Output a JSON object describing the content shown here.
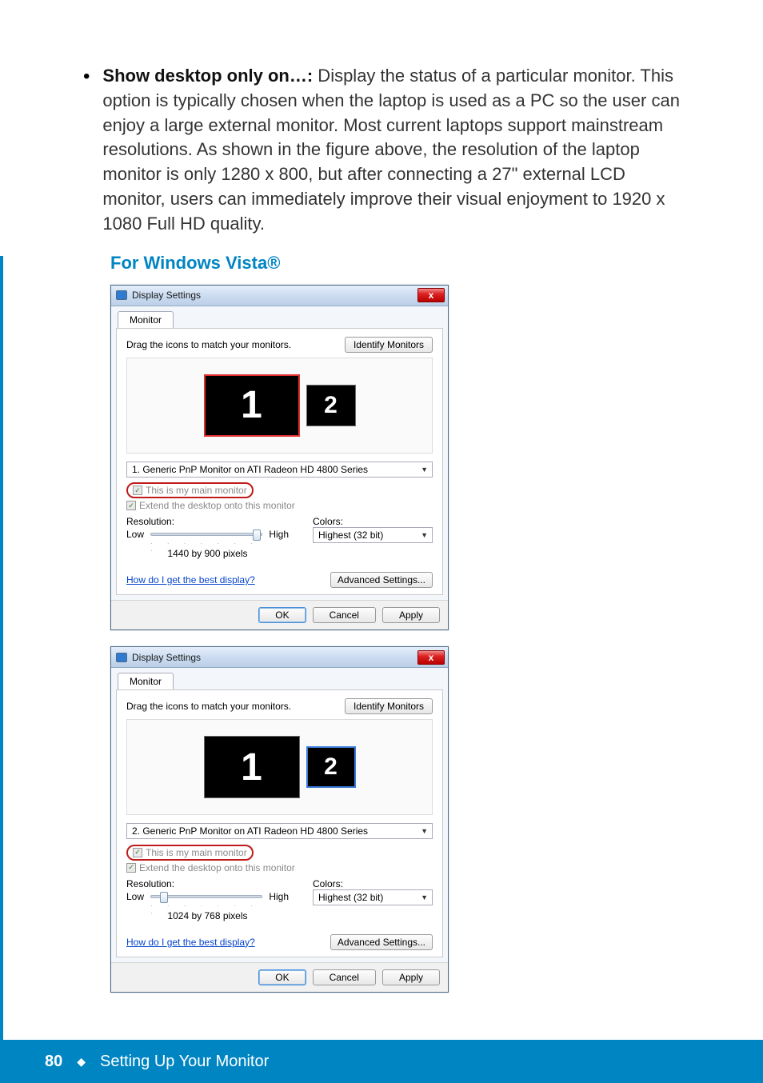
{
  "page": {
    "bullet_heading": "Show desktop only on…:",
    "bullet_body": " Display the status of a particular monitor. This option is typically chosen when the laptop is used as a PC so the user can enjoy a large external monitor. Most current laptops support mainstream resolutions. As shown in the figure above, the resolution of the laptop monitor is only 1280 x 800, but after connecting a 27\" external LCD monitor, users can immediately improve their visual enjoyment to 1920 x 1080 Full HD quality.",
    "vista_heading": "For Windows Vista®",
    "page_number": "80",
    "diamond": "◆",
    "section_title": "Setting Up Your Monitor"
  },
  "labels": {
    "window_title": "Display Settings",
    "monitor_tab": "Monitor",
    "drag_instruction": "Drag the icons to match your monitors.",
    "identify_monitors": "Identify Monitors",
    "main_monitor_cb": "This is my main monitor",
    "extend_cb": "Extend the desktop onto this monitor",
    "resolution_label": "Resolution:",
    "low": "Low",
    "high": "High",
    "colors_label": "Colors:",
    "help_link": "How do I get the best display?",
    "advanced": "Advanced Settings...",
    "ok": "OK",
    "cancel": "Cancel",
    "apply": "Apply",
    "close_x": "x",
    "check": "✓",
    "caret": "▼"
  },
  "dialog1": {
    "monitor1_num": "1",
    "monitor2_num": "2",
    "selected_display": "1. Generic PnP Monitor on ATI Radeon HD 4800 Series",
    "resolution_value": "1440 by 900 pixels",
    "colors_value": "Highest (32 bit)",
    "slider_pos_pct": "92"
  },
  "dialog2": {
    "monitor1_num": "1",
    "monitor2_num": "2",
    "selected_display": "2. Generic PnP Monitor on ATI Radeon HD 4800 Series",
    "resolution_value": "1024 by 768 pixels",
    "colors_value": "Highest (32 bit)",
    "slider_pos_pct": "8"
  }
}
